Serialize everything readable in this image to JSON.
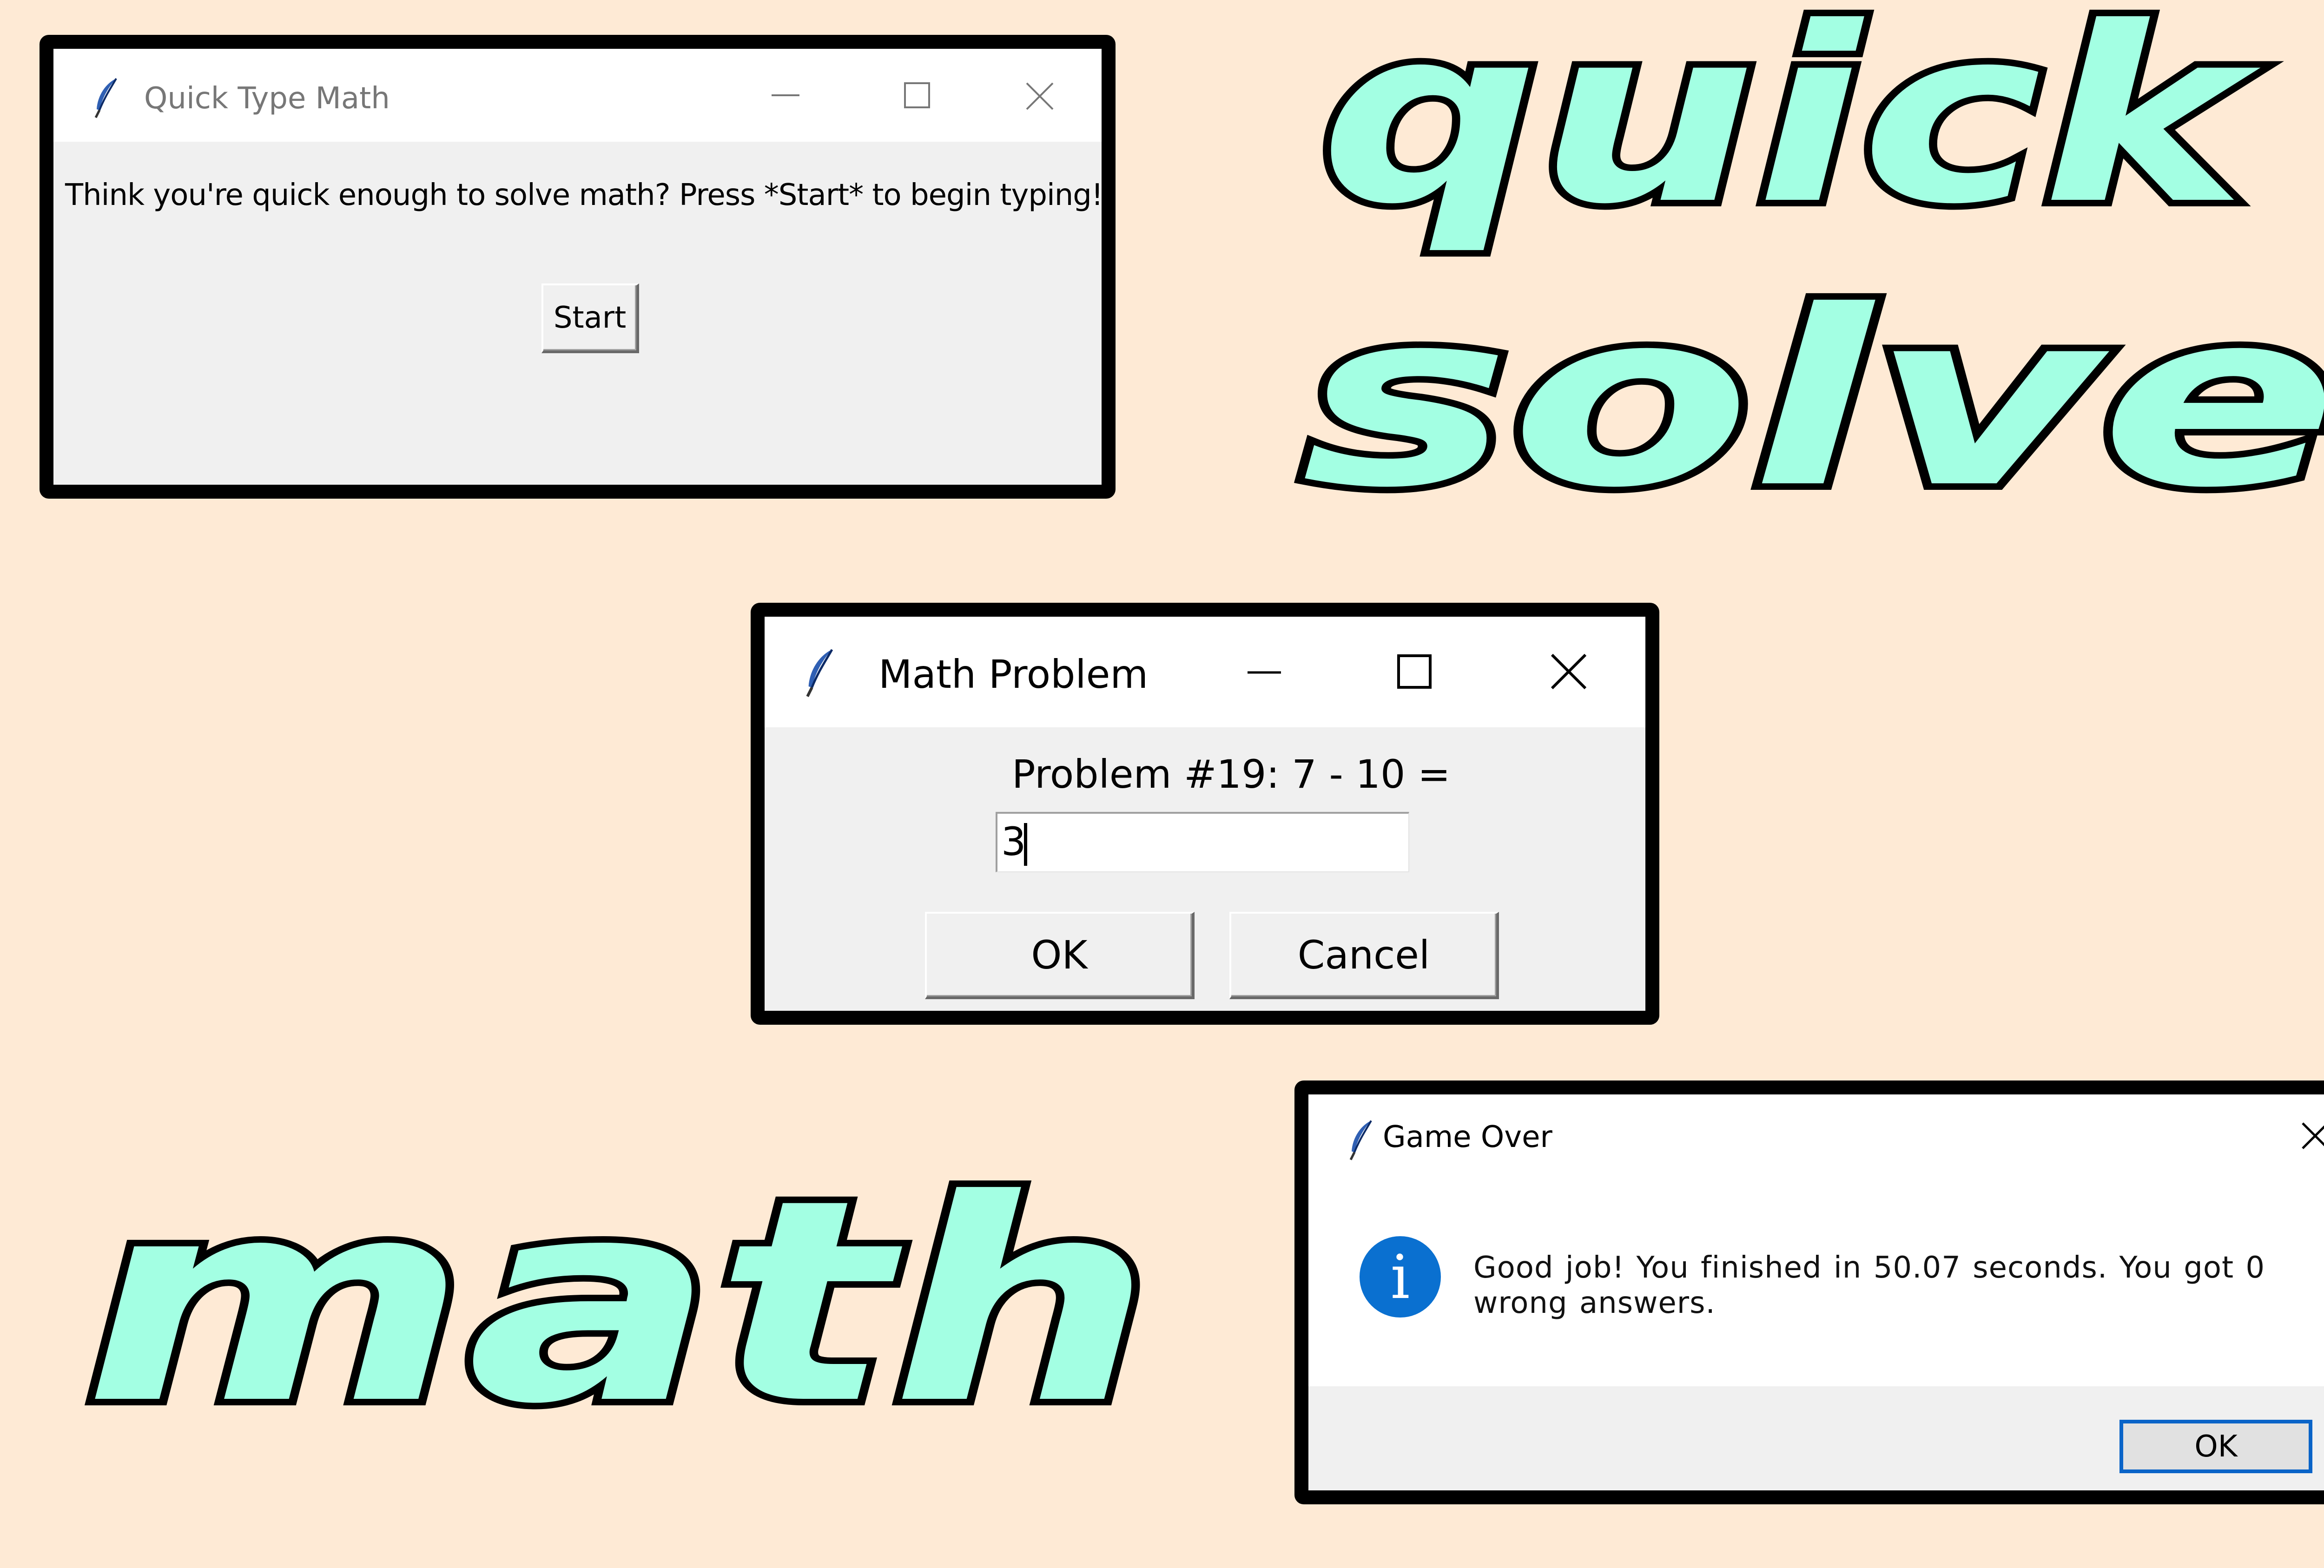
{
  "colors": {
    "background": "#FEEAD5",
    "logo_fill": "#A3FFE3",
    "logo_outline": "#000000",
    "info_icon": "#0A70D0",
    "ok_focus_border": "#0A64C8"
  },
  "logo": {
    "line1": "quick",
    "line2": "solve",
    "line3": "math"
  },
  "start_window": {
    "title": "Quick Type Math",
    "icon": "feather-icon",
    "message": "Think you're quick enough to solve math? Press *Start* to begin typing!",
    "start_label": "Start"
  },
  "problem_window": {
    "title": "Math Problem",
    "icon": "feather-icon",
    "prompt": "Problem #19: 7 - 10 =",
    "answer_value": "3",
    "ok_label": "OK",
    "cancel_label": "Cancel"
  },
  "gameover_window": {
    "title": "Game Over",
    "icon": "feather-icon",
    "info_icon": "info-icon",
    "info_glyph": "i",
    "message": "Good job! You finished in 50.07 seconds. You got 0 wrong answers.",
    "ok_label": "OK"
  }
}
